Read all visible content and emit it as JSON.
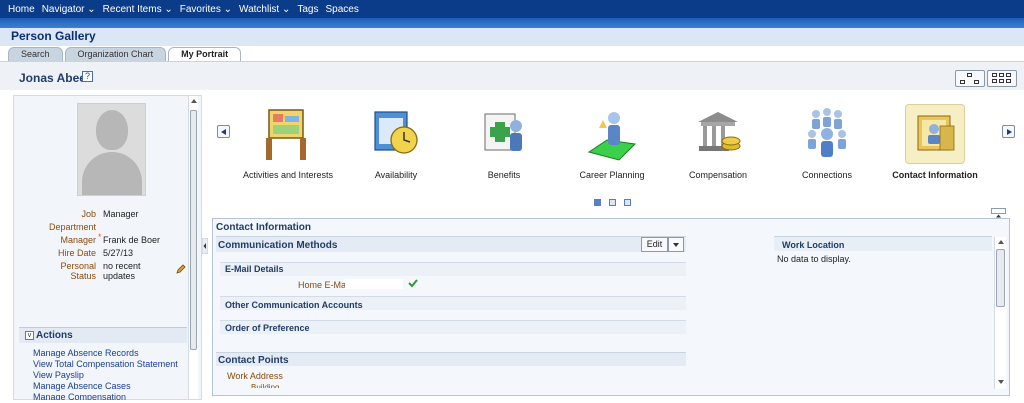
{
  "topnav": [
    "Home",
    "Navigator ⌄",
    "Recent Items ⌄",
    "Favorites ⌄",
    "Watchlist ⌄",
    "Tags",
    "Spaces"
  ],
  "app_title": "Person Gallery",
  "tabs": [
    {
      "label": "Search",
      "active": false
    },
    {
      "label": "Organization Chart",
      "active": false
    },
    {
      "label": "My Portrait",
      "active": true
    }
  ],
  "person": {
    "name": "Jonas Abee",
    "help_glyph": "?",
    "job_label": "Job",
    "job": "Manager",
    "department_label": "Department",
    "department": "",
    "manager_label": "Manager",
    "manager_marker": "*",
    "manager": "Frank de Boer",
    "hire_date_label": "Hire Date",
    "hire_date": "5/27/13",
    "personal_status_label_1": "Personal",
    "personal_status_label_2": "Status",
    "personal_status_1": "no recent",
    "personal_status_2": "updates"
  },
  "actions": {
    "toggle_glyph": "v",
    "title": "Actions",
    "links": [
      "Manage Absence Records",
      "View Total Compensation Statement",
      "View Payslip",
      "Manage Absence Cases",
      "Manage Compensation"
    ]
  },
  "categories": [
    {
      "label": "Activities and Interests",
      "icon": "activities-icon",
      "selected": false
    },
    {
      "label": "Availability",
      "icon": "availability-icon",
      "selected": false
    },
    {
      "label": "Benefits",
      "icon": "benefits-icon",
      "selected": false
    },
    {
      "label": "Career Planning",
      "icon": "career-planning-icon",
      "selected": false
    },
    {
      "label": "Compensation",
      "icon": "compensation-icon",
      "selected": false
    },
    {
      "label": "Connections",
      "icon": "connections-icon",
      "selected": false
    },
    {
      "label": "Contact Information",
      "icon": "contact-information-icon",
      "selected": true
    }
  ],
  "carousel": {
    "pages": 3,
    "active_page": 1
  },
  "contact": {
    "panel_title": "Contact Information",
    "comm_methods": "Communication Methods",
    "edit_label": "Edit",
    "email_details": "E-Mail Details",
    "home_email_label": "Home E-Mail",
    "other_accounts": "Other Communication Accounts",
    "order_pref": "Order of Preference",
    "contact_points": "Contact Points",
    "work_address": "Work Address",
    "building": "Building",
    "work_location": "Work Location",
    "no_data": "No data to display."
  },
  "colors": {
    "nav": "#0b3c8a",
    "link": "#1a3f8f",
    "label": "#8a4b0b",
    "heading": "#203c68",
    "selected_bg": "#f6efc3"
  }
}
